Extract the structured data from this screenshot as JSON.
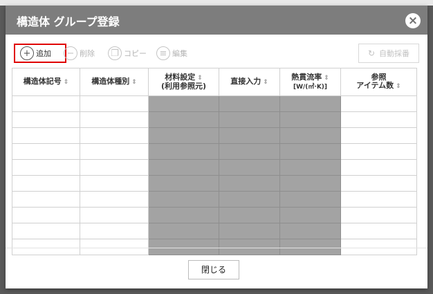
{
  "modal": {
    "title": "構造体 グループ登録",
    "close_icon": "×"
  },
  "toolbar": {
    "add_label": "追加",
    "delete_label": "削除",
    "copy_label": "コピー",
    "edit_label": "編集",
    "auto_label": "自動採番"
  },
  "table": {
    "headers": {
      "col1": "構造体記号",
      "col2": "構造体種別",
      "col3_line1": "材料設定",
      "col3_line2": "(利用参照元)",
      "col4": "直接入力",
      "col5_line1": "熱貫流率",
      "col5_line2": "[W/(㎡·K)]",
      "col6_line1": "参照",
      "col6_line2": "アイテム数"
    }
  },
  "footer": {
    "close_label": "閉じる"
  },
  "colors": {
    "header_bg": "#7d7d7d",
    "shaded_cell": "#a3a3a3",
    "highlight": "#e00000"
  }
}
